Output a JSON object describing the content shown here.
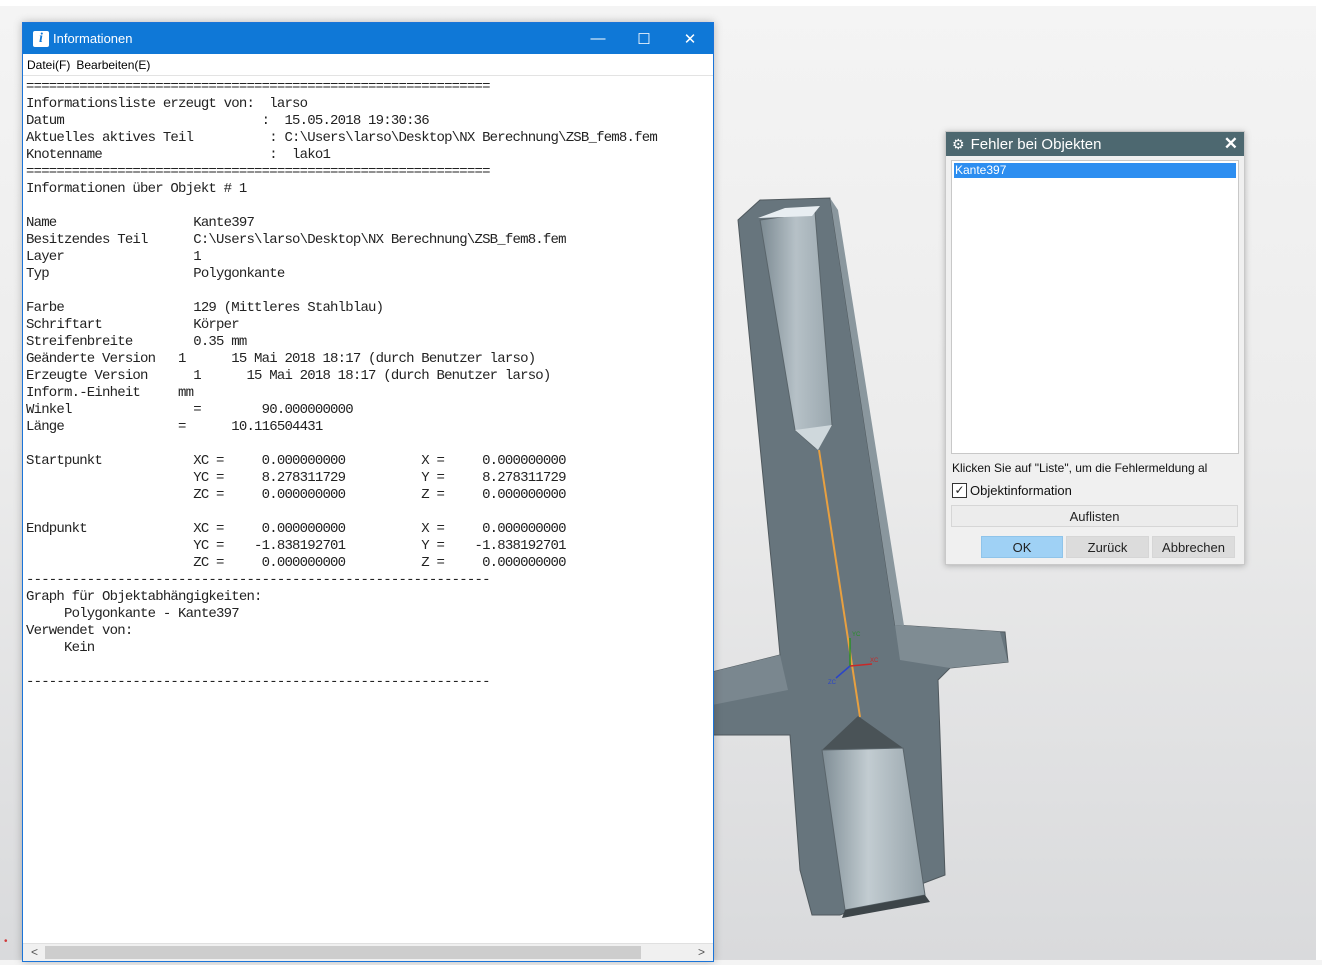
{
  "info_window": {
    "title": "Informationen",
    "menu": [
      "Datei(F)",
      "Bearbeiten(E)"
    ],
    "lines": [
      "=============================================================",
      "Informationsliste erzeugt von:  larso",
      "Datum                          :  15.05.2018 19:30:36",
      "Aktuelles aktives Teil          : C:\\Users\\larso\\Desktop\\NX Berechnung\\ZSB_fem8.fem",
      "Knotenname                      :  lako1",
      "=============================================================",
      "Informationen über Objekt # 1",
      "",
      "Name                  Kante397",
      "Besitzendes Teil      C:\\Users\\larso\\Desktop\\NX Berechnung\\ZSB_fem8.fem",
      "Layer                 1",
      "Typ                   Polygonkante",
      "",
      "Farbe                 129 (Mittleres Stahlblau)",
      "Schriftart            Körper",
      "Streifenbreite        0.35 mm",
      "Geänderte Version   1      15 Mai 2018 18:17 (durch Benutzer larso)",
      "Erzeugte Version      1      15 Mai 2018 18:17 (durch Benutzer larso)",
      "Inform.-Einheit     mm",
      "Winkel                =        90.000000000",
      "Länge               =      10.116504431",
      "",
      "Startpunkt            XC =     0.000000000          X =     0.000000000",
      "                      YC =     8.278311729          Y =     8.278311729",
      "                      ZC =     0.000000000          Z =     0.000000000",
      "",
      "Endpunkt              XC =     0.000000000          X =     0.000000000",
      "                      YC =    -1.838192701          Y =    -1.838192701",
      "                      ZC =     0.000000000          Z =     0.000000000",
      "-------------------------------------------------------------",
      "Graph für Objektabhängigkeiten:",
      "     Polygonkante - Kante397",
      "Verwendet von:",
      "     Kein",
      "",
      "-------------------------------------------------------------"
    ]
  },
  "error_dialog": {
    "title": "Fehler bei Objekten",
    "items": [
      "Kante397"
    ],
    "message": "Klicken Sie auf \"Liste\", um die Fehlermeldung al",
    "checkbox_label": "Objektinformation",
    "checkbox_checked": true,
    "list_button": "Auflisten",
    "ok_button": "OK",
    "back_button": "Zurück",
    "cancel_button": "Abbrechen"
  },
  "triad": {
    "yc": "YC",
    "xc": "XC",
    "zc": "ZC"
  },
  "colors": {
    "titlebar_blue": "#0f78d7",
    "dialog_title": "#4d6870",
    "selection_blue": "#2d8ef0",
    "model_gray": "#6f7d85",
    "edge_highlight": "#e8a040"
  }
}
